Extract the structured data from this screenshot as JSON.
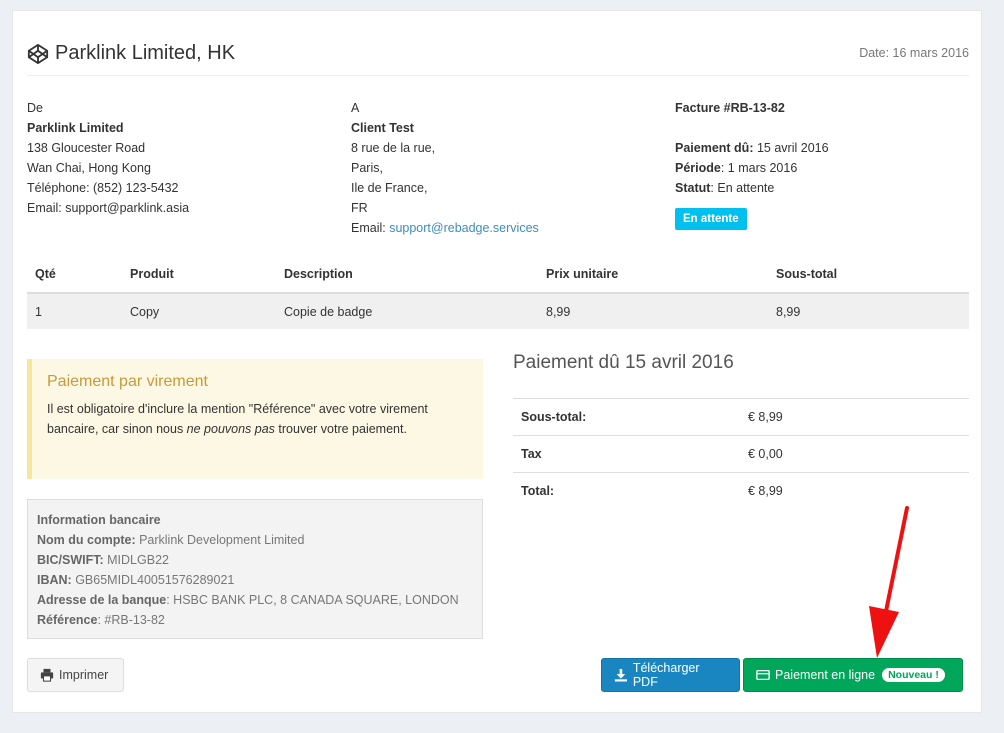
{
  "header": {
    "company": "Parklink Limited, HK",
    "date": "Date: 16 mars 2016"
  },
  "from": {
    "label": "De",
    "name": "Parklink Limited",
    "address1": "138 Gloucester Road",
    "address2": "Wan Chai, Hong Kong",
    "phone": "Téléphone: (852) 123-5432",
    "email": "Email: support@parklink.asia"
  },
  "to": {
    "label": "A",
    "name": "Client Test",
    "address1": "8 rue de la rue,",
    "city": "Paris,",
    "region": "Ile de France,",
    "country": "FR",
    "email_label": "Email: ",
    "email": "support@rebadge.services"
  },
  "invoice": {
    "number": "Facture #RB-13-82",
    "due_label": "Paiement dû:",
    "due_value": " 15 avril 2016",
    "period_label": "Période",
    "period_value": ": 1 mars 2016",
    "status_label": "Statut",
    "status_value": ": En attente",
    "status_badge": "En attente",
    "status_color": "#00c0ef"
  },
  "items": {
    "headers": [
      "Qté",
      "Produit",
      "Description",
      "Prix unitaire",
      "Sous-total"
    ],
    "rows": [
      [
        "1",
        "Copy",
        "Copie de badge",
        "8,99",
        "8,99"
      ]
    ]
  },
  "callout": {
    "title": "Paiement par virement",
    "text_before": "Il est obligatoire d'inclure la mention \"Référence\" avec votre virement bancaire, car sinon nous ",
    "text_em": "ne pouvons pas",
    "text_after": " trouver votre paiement."
  },
  "bank": {
    "title": "Information bancaire",
    "account_label": "Nom du compte:",
    "account_value": " Parklink Development Limited",
    "bic_label": "BIC/SWIFT:",
    "bic_value": " MIDLGB22",
    "iban_label": "IBAN:",
    "iban_value": " GB65MIDL40051576289021",
    "address_label": "Adresse de la banque",
    "address_value": ": HSBC BANK PLC, 8 CANADA SQUARE, LONDON",
    "ref_label": "Référence",
    "ref_value": ": #RB-13-82"
  },
  "payment": {
    "title": "Paiement dû 15 avril 2016",
    "rows": [
      {
        "label": "Sous-total:",
        "value": "€ 8,99"
      },
      {
        "label": "Tax",
        "value": "€ 0,00"
      },
      {
        "label": "Total:",
        "value": "€ 8,99"
      }
    ]
  },
  "buttons": {
    "print": "Imprimer",
    "pdf": "Télécharger PDF",
    "online": "Paiement en ligne",
    "new_badge": "Nouveau !"
  },
  "icons": {
    "brand": "codepen-icon",
    "print": "print-icon",
    "download": "download-icon",
    "card": "credit-card-icon",
    "arrow": "red-arrow-annotation"
  },
  "colors": {
    "primary": "#1a86c1",
    "success": "#00a65a",
    "warning_bg": "#fcf8e3",
    "arrow": "#ee1111"
  }
}
